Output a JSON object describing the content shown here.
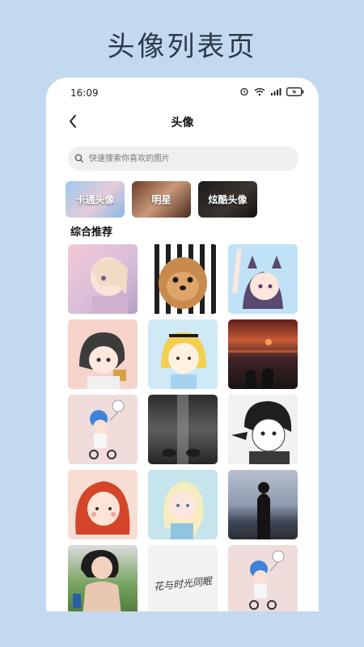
{
  "banner": {
    "title": "头像列表页"
  },
  "status_bar": {
    "time": "16:09"
  },
  "nav": {
    "title": "头像"
  },
  "search": {
    "placeholder": "快速搜索你喜欢的图片"
  },
  "categories": [
    {
      "label": "卡通头像"
    },
    {
      "label": "明星"
    },
    {
      "label": "炫酷头像"
    }
  ],
  "section": {
    "title": "综合推荐"
  },
  "calligraphy_text": "花与时光同眠",
  "colors": {
    "background": "#c3d9ef",
    "search_bg": "#efefef",
    "card_bg": "#ffffff"
  },
  "icons": [
    "back-arrow-icon",
    "search-icon",
    "alarm-icon",
    "wifi-icon",
    "signal-icon",
    "battery-icon"
  ]
}
